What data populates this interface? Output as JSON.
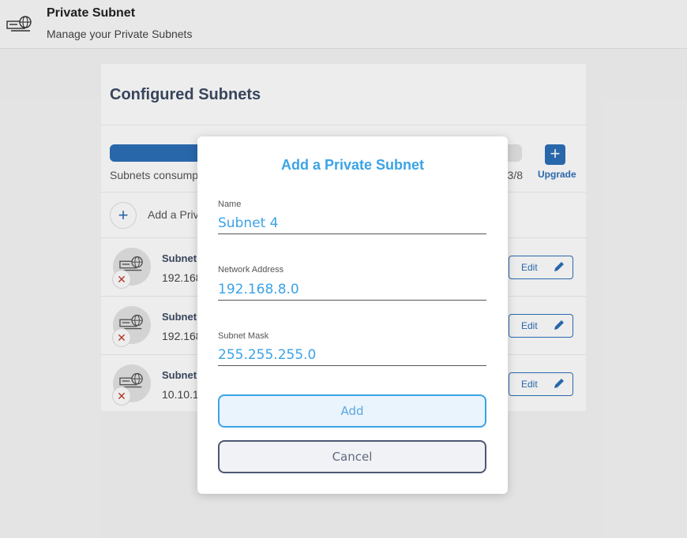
{
  "header": {
    "title": "Private Subnet",
    "subtitle": "Manage your Private Subnets",
    "icon": "network-globe-icon"
  },
  "card": {
    "title": "Configured Subnets"
  },
  "usage": {
    "label": "Subnets consump",
    "count": "3/8",
    "fill_fraction": 0.375,
    "upgrade_label": "Upgrade",
    "upgrade_icon": "plus-icon"
  },
  "add_row": {
    "label": "Add a Priv",
    "icon": "plus-icon"
  },
  "subnets": [
    {
      "name": "Subnet",
      "address": "192.168"
    },
    {
      "name": "Subnet",
      "address": "192.168"
    },
    {
      "name": "Subnet",
      "address": "10.10.1"
    }
  ],
  "row_actions": {
    "edit_label": "Edit",
    "edit_icon": "pencil-icon",
    "remove_icon": "close-icon",
    "remove_glyph": "✕"
  },
  "modal": {
    "title": "Add a Private Subnet",
    "fields": {
      "name": {
        "label": "Name",
        "value": "Subnet 4"
      },
      "network": {
        "label": "Network Address",
        "value": "192.168.8.0"
      },
      "mask": {
        "label": "Subnet Mask",
        "value": "255.255.255.0"
      }
    },
    "add_label": "Add",
    "cancel_label": "Cancel"
  },
  "colors": {
    "accent": "#3ba3e6",
    "brand": "#2d6fb8",
    "danger": "#c0392b",
    "title_text": "#3d4b63"
  }
}
